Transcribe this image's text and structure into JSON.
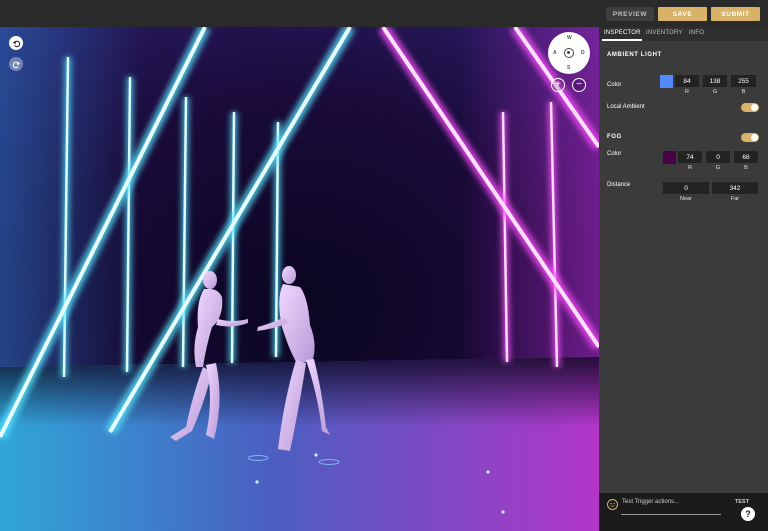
{
  "topbar": {
    "preview_label": "PREVIEW",
    "save_label": "SAVE",
    "submit_label": "SUBMIT"
  },
  "viewport": {
    "compass": {
      "n": "W",
      "w": "A",
      "s": "S",
      "e": "D"
    },
    "zoom_in_label": "+",
    "zoom_out_label": "−"
  },
  "panel": {
    "tabs": [
      {
        "label": "INSPECTOR",
        "active": true
      },
      {
        "label": "INVENTORY",
        "active": false
      },
      {
        "label": "INFO",
        "active": false
      }
    ],
    "ambient": {
      "title": "AMBIENT LIGHT",
      "color_label": "Color",
      "color_hex": "#5488ff",
      "r": "84",
      "g": "138",
      "b": "255",
      "r_label": "R",
      "g_label": "G",
      "b_label": "B",
      "local_ambient_label": "Local Ambient",
      "local_ambient_on": true
    },
    "fog": {
      "title": "FOG",
      "enabled": true,
      "color_label": "Color",
      "color_hex": "#4a0044",
      "r": "74",
      "g": "0",
      "b": "68",
      "r_label": "R",
      "g_label": "G",
      "b_label": "B",
      "distance_label": "Distance",
      "near": "0",
      "far": "342",
      "near_label": "Near",
      "far_label": "Far"
    }
  },
  "chat": {
    "placeholder": "Test Trigger actions...",
    "test_label": "TEST",
    "help_label": "?"
  },
  "colors": {
    "accent": "#d8b267",
    "panel_bg": "#3b3b3b",
    "neon_cyan": "#3fd8ff",
    "neon_magenta": "#ff4dff"
  }
}
